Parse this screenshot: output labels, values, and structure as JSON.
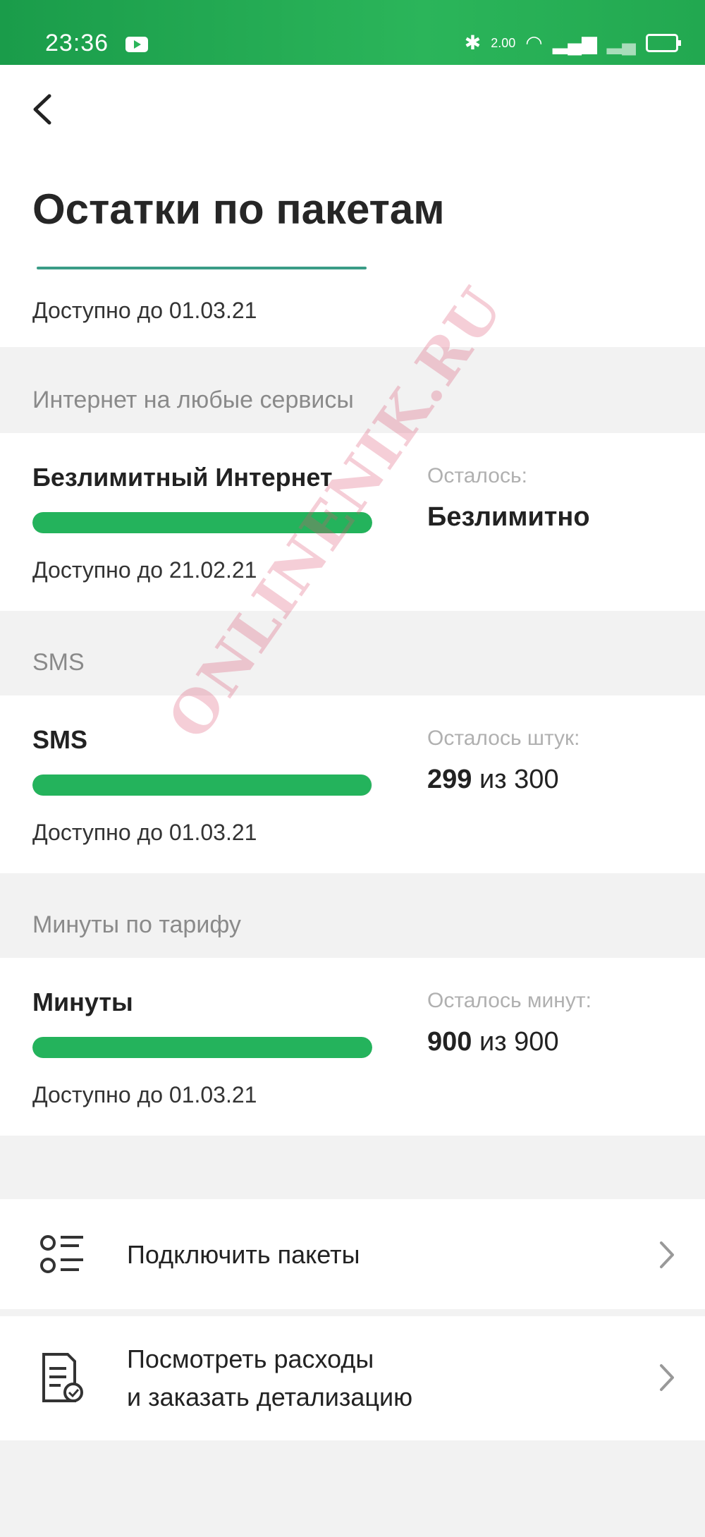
{
  "status_bar": {
    "time": "23:36",
    "net_speed": "2.00"
  },
  "header": {
    "title": "Остатки по пакетам",
    "available": "Доступно до 01.03.21"
  },
  "internet": {
    "section_label": "Интернет на любые сервисы",
    "name": "Безлимитный Интернет",
    "remaining_label": "Осталось:",
    "remaining_value": "Безлимитно",
    "available": "Доступно до 21.02.21",
    "fill": 1.0
  },
  "sms": {
    "section_label": "SMS",
    "name": "SMS",
    "remaining_label": "Осталось штук:",
    "remaining_count": "299",
    "remaining_total": "из 300",
    "available": "Доступно до 01.03.21",
    "fill": 0.997
  },
  "minutes": {
    "section_label": "Минуты по тарифу",
    "name": "Минуты",
    "remaining_label": "Осталось минут:",
    "remaining_count": "900",
    "remaining_total": "из 900",
    "available": "Доступно до 01.03.21",
    "fill": 1.0
  },
  "actions": {
    "connect_packages": "Подключить пакеты",
    "view_expenses_line1": "Посмотреть расходы",
    "view_expenses_line2": "и заказать детализацию"
  },
  "watermark": "ONLINENIK.RU",
  "colors": {
    "accent": "#24b35c",
    "status_bar": "#2bb55a"
  }
}
